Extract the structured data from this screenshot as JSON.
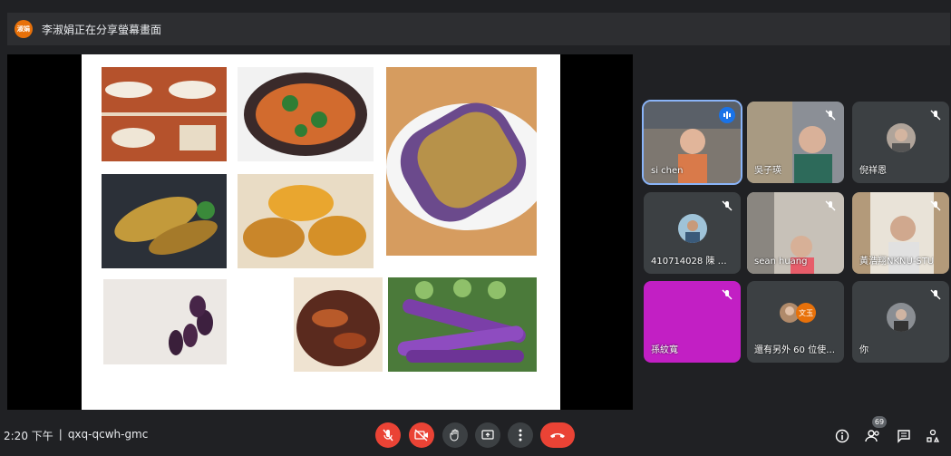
{
  "banner": {
    "avatar_text": "淑娟",
    "text": "李淑娟正在分享螢幕畫面"
  },
  "participants": [
    {
      "name": "si chen"
    },
    {
      "name": "吳子瑛"
    },
    {
      "name": "倪祥恩"
    },
    {
      "name": "410714028 陳 請..."
    },
    {
      "name": "sean huang"
    },
    {
      "name": "黃浩翔NKNU-STU"
    },
    {
      "name": "孫紋寬"
    },
    {
      "name": "還有另外 60 位使用者",
      "badge": "文玉"
    },
    {
      "name": "你"
    }
  ],
  "bottombar": {
    "time": "2:20 下午",
    "separator": "|",
    "meeting_code": "qxq-qcwh-gmc",
    "people_count": "69"
  },
  "colors": {
    "background": "#202124",
    "tile": "#3c4043",
    "danger": "#ea4335",
    "speaking": "#1a73e8",
    "accent_tile": "#c21fc4"
  }
}
